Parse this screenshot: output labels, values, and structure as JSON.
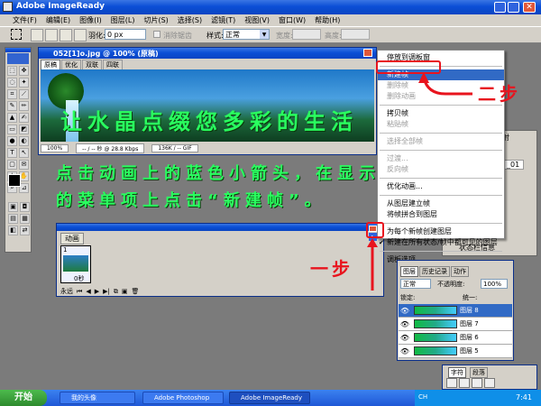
{
  "window": {
    "title": "Adobe ImageReady"
  },
  "menubar": [
    "文件(F)",
    "编辑(E)",
    "图像(I)",
    "图层(L)",
    "切片(S)",
    "选择(S)",
    "滤镜(T)",
    "视图(V)",
    "窗口(W)",
    "帮助(H)"
  ],
  "options": {
    "feather_label": "羽化:",
    "feather_value": "0 px",
    "antialias": "消除锯齿",
    "style_label": "样式:",
    "style_value": "正常",
    "width_label": "宽度:",
    "width_value": "",
    "height_label": "高度:",
    "height_value": ""
  },
  "doc": {
    "title": "052[1]o.jpg @ 100% (原稿)",
    "tabs": [
      "原稿",
      "优化",
      "双联",
      "四联"
    ],
    "banner_text": "让水晶点缀您多彩的生活",
    "status": {
      "zoom": "100%",
      "time": "-- / -- 秒 @ 28.8 Kbps",
      "size": "136K / -- GIF"
    }
  },
  "instruction": {
    "line1": "点击动画上的蓝色小箭头，在显示",
    "line2": "的菜单项上点击“新建帧”。"
  },
  "annotations": {
    "step1": "一步",
    "step2": "二步"
  },
  "animation": {
    "tab": "动画",
    "frame_no": "1",
    "frame_delay": "0秒",
    "loop": "永远"
  },
  "context_menu": {
    "items": [
      {
        "label": "停放到调板窗",
        "state": "normal"
      },
      {
        "sep": true
      },
      {
        "label": "新建帧",
        "state": "highlight"
      },
      {
        "label": "删除帧",
        "state": "disabled"
      },
      {
        "label": "删除动画",
        "state": "disabled"
      },
      {
        "sep": true
      },
      {
        "label": "拷贝帧",
        "state": "normal"
      },
      {
        "label": "粘贴帧",
        "state": "disabled"
      },
      {
        "sep": true
      },
      {
        "label": "选择全部帧",
        "state": "disabled"
      },
      {
        "sep": true
      },
      {
        "label": "过渡...",
        "state": "disabled"
      },
      {
        "label": "反向帧",
        "state": "disabled"
      },
      {
        "sep": true
      },
      {
        "label": "优化动画...",
        "state": "normal"
      },
      {
        "sep": true
      },
      {
        "label": "从图层建立帧",
        "state": "normal"
      },
      {
        "label": "将帧拼合到图层",
        "state": "normal"
      },
      {
        "sep": true
      },
      {
        "label": "为每个新帧创建图层",
        "state": "normal"
      },
      {
        "label": "新建在所有状态/帧中都可见的图层",
        "state": "checked"
      },
      {
        "sep": true
      },
      {
        "label": "调板选项...",
        "state": "normal"
      }
    ]
  },
  "right_panel": {
    "tab_partial": "射",
    "field_value": "_01",
    "item_tail": "尾",
    "item_state": "状态栏信息"
  },
  "layers": {
    "tabs": [
      "图层",
      "历史记录",
      "动作"
    ],
    "blend": "正常",
    "opacity_label": "不透明度:",
    "opacity": "100%",
    "lock_label": "锁定:",
    "unify_label": "统一:",
    "rows": [
      "图层 8",
      "图层 7",
      "图层 6",
      "图层 5"
    ]
  },
  "char_panel": {
    "tabs": [
      "字符",
      "段落"
    ]
  },
  "taskbar": {
    "start": "开始",
    "items": [
      "我的头像",
      "Adobe Photoshop",
      "Adobe ImageReady"
    ],
    "ime": "CH",
    "clock": "7:41"
  }
}
